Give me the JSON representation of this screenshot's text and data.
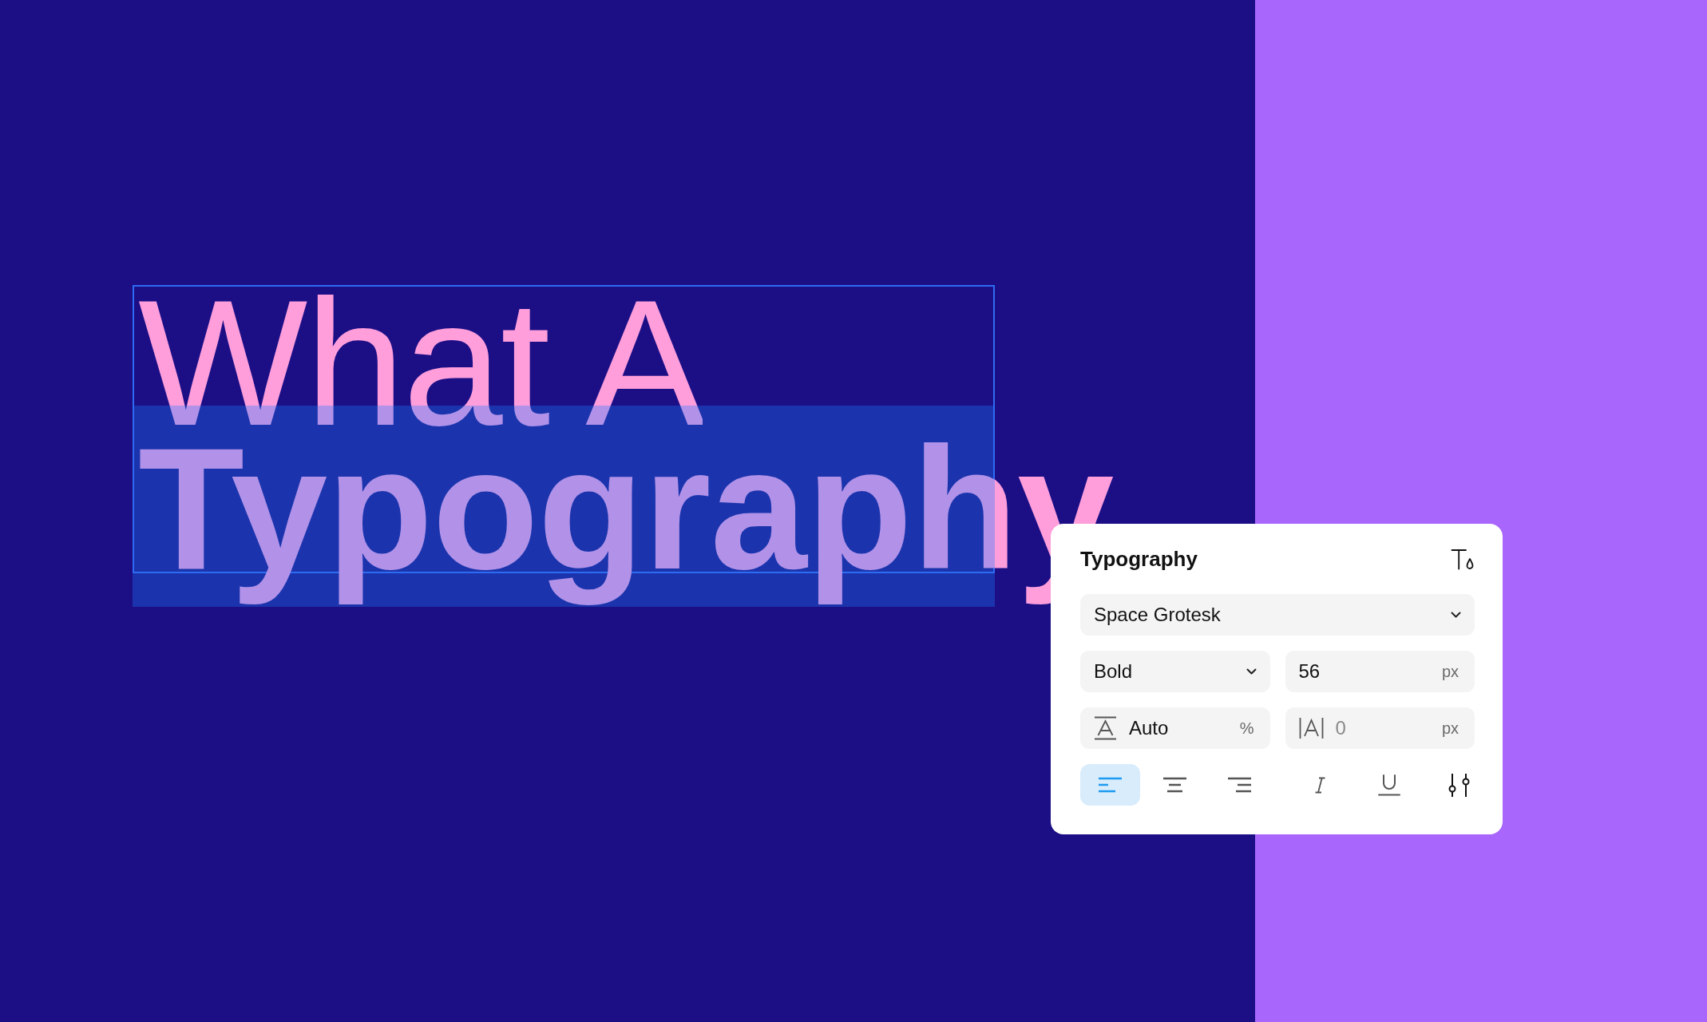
{
  "canvas": {
    "text_layer": {
      "selected": true,
      "lines": [
        {
          "text": "What A",
          "kind": "light"
        },
        {
          "text": "Typography",
          "kind": "bold"
        }
      ]
    }
  },
  "typography_panel": {
    "title": "Typography",
    "font_family": {
      "value": "Space Grotesk"
    },
    "font_weight": {
      "value": "Bold"
    },
    "font_size": {
      "value": "56",
      "unit": "px"
    },
    "line_height": {
      "value": "Auto",
      "unit": "%"
    },
    "letter_spacing": {
      "placeholder": "0",
      "unit": "px"
    },
    "alignment": [
      {
        "kind": "left",
        "selected": true
      },
      {
        "kind": "center",
        "selected": false
      },
      {
        "kind": "right",
        "selected": false
      }
    ],
    "text_styles": [
      {
        "kind": "italic",
        "on": false
      },
      {
        "kind": "underline",
        "on": false
      }
    ]
  }
}
